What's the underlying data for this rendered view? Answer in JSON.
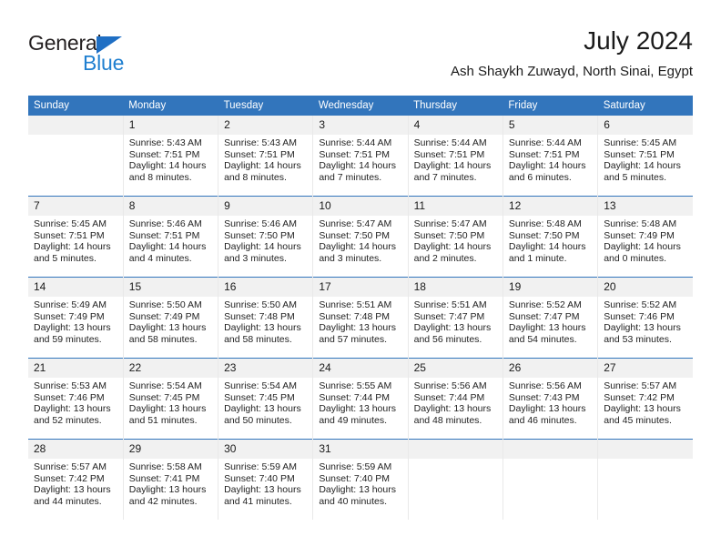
{
  "brand": {
    "name_part1": "General",
    "name_part2": "Blue"
  },
  "header": {
    "title": "July 2024",
    "subtitle": "Ash Shaykh Zuwayd, North Sinai, Egypt"
  },
  "colors": {
    "header_blue": "#3275bc",
    "logo_blue": "#1f7fd0",
    "daynum_band": "#f1f1f1"
  },
  "weekday_headers": [
    "Sunday",
    "Monday",
    "Tuesday",
    "Wednesday",
    "Thursday",
    "Friday",
    "Saturday"
  ],
  "labels": {
    "sunrise_prefix": "Sunrise:",
    "sunset_prefix": "Sunset:",
    "daylight_prefix": "Daylight:"
  },
  "weeks": [
    [
      {
        "day": "",
        "empty": true
      },
      {
        "day": "1",
        "sunrise": "Sunrise: 5:43 AM",
        "sunset": "Sunset: 7:51 PM",
        "daylight1": "Daylight: 14 hours",
        "daylight2": "and 8 minutes."
      },
      {
        "day": "2",
        "sunrise": "Sunrise: 5:43 AM",
        "sunset": "Sunset: 7:51 PM",
        "daylight1": "Daylight: 14 hours",
        "daylight2": "and 8 minutes."
      },
      {
        "day": "3",
        "sunrise": "Sunrise: 5:44 AM",
        "sunset": "Sunset: 7:51 PM",
        "daylight1": "Daylight: 14 hours",
        "daylight2": "and 7 minutes."
      },
      {
        "day": "4",
        "sunrise": "Sunrise: 5:44 AM",
        "sunset": "Sunset: 7:51 PM",
        "daylight1": "Daylight: 14 hours",
        "daylight2": "and 7 minutes."
      },
      {
        "day": "5",
        "sunrise": "Sunrise: 5:44 AM",
        "sunset": "Sunset: 7:51 PM",
        "daylight1": "Daylight: 14 hours",
        "daylight2": "and 6 minutes."
      },
      {
        "day": "6",
        "sunrise": "Sunrise: 5:45 AM",
        "sunset": "Sunset: 7:51 PM",
        "daylight1": "Daylight: 14 hours",
        "daylight2": "and 5 minutes."
      }
    ],
    [
      {
        "day": "7",
        "sunrise": "Sunrise: 5:45 AM",
        "sunset": "Sunset: 7:51 PM",
        "daylight1": "Daylight: 14 hours",
        "daylight2": "and 5 minutes."
      },
      {
        "day": "8",
        "sunrise": "Sunrise: 5:46 AM",
        "sunset": "Sunset: 7:51 PM",
        "daylight1": "Daylight: 14 hours",
        "daylight2": "and 4 minutes."
      },
      {
        "day": "9",
        "sunrise": "Sunrise: 5:46 AM",
        "sunset": "Sunset: 7:50 PM",
        "daylight1": "Daylight: 14 hours",
        "daylight2": "and 3 minutes."
      },
      {
        "day": "10",
        "sunrise": "Sunrise: 5:47 AM",
        "sunset": "Sunset: 7:50 PM",
        "daylight1": "Daylight: 14 hours",
        "daylight2": "and 3 minutes."
      },
      {
        "day": "11",
        "sunrise": "Sunrise: 5:47 AM",
        "sunset": "Sunset: 7:50 PM",
        "daylight1": "Daylight: 14 hours",
        "daylight2": "and 2 minutes."
      },
      {
        "day": "12",
        "sunrise": "Sunrise: 5:48 AM",
        "sunset": "Sunset: 7:50 PM",
        "daylight1": "Daylight: 14 hours",
        "daylight2": "and 1 minute."
      },
      {
        "day": "13",
        "sunrise": "Sunrise: 5:48 AM",
        "sunset": "Sunset: 7:49 PM",
        "daylight1": "Daylight: 14 hours",
        "daylight2": "and 0 minutes."
      }
    ],
    [
      {
        "day": "14",
        "sunrise": "Sunrise: 5:49 AM",
        "sunset": "Sunset: 7:49 PM",
        "daylight1": "Daylight: 13 hours",
        "daylight2": "and 59 minutes."
      },
      {
        "day": "15",
        "sunrise": "Sunrise: 5:50 AM",
        "sunset": "Sunset: 7:49 PM",
        "daylight1": "Daylight: 13 hours",
        "daylight2": "and 58 minutes."
      },
      {
        "day": "16",
        "sunrise": "Sunrise: 5:50 AM",
        "sunset": "Sunset: 7:48 PM",
        "daylight1": "Daylight: 13 hours",
        "daylight2": "and 58 minutes."
      },
      {
        "day": "17",
        "sunrise": "Sunrise: 5:51 AM",
        "sunset": "Sunset: 7:48 PM",
        "daylight1": "Daylight: 13 hours",
        "daylight2": "and 57 minutes."
      },
      {
        "day": "18",
        "sunrise": "Sunrise: 5:51 AM",
        "sunset": "Sunset: 7:47 PM",
        "daylight1": "Daylight: 13 hours",
        "daylight2": "and 56 minutes."
      },
      {
        "day": "19",
        "sunrise": "Sunrise: 5:52 AM",
        "sunset": "Sunset: 7:47 PM",
        "daylight1": "Daylight: 13 hours",
        "daylight2": "and 54 minutes."
      },
      {
        "day": "20",
        "sunrise": "Sunrise: 5:52 AM",
        "sunset": "Sunset: 7:46 PM",
        "daylight1": "Daylight: 13 hours",
        "daylight2": "and 53 minutes."
      }
    ],
    [
      {
        "day": "21",
        "sunrise": "Sunrise: 5:53 AM",
        "sunset": "Sunset: 7:46 PM",
        "daylight1": "Daylight: 13 hours",
        "daylight2": "and 52 minutes."
      },
      {
        "day": "22",
        "sunrise": "Sunrise: 5:54 AM",
        "sunset": "Sunset: 7:45 PM",
        "daylight1": "Daylight: 13 hours",
        "daylight2": "and 51 minutes."
      },
      {
        "day": "23",
        "sunrise": "Sunrise: 5:54 AM",
        "sunset": "Sunset: 7:45 PM",
        "daylight1": "Daylight: 13 hours",
        "daylight2": "and 50 minutes."
      },
      {
        "day": "24",
        "sunrise": "Sunrise: 5:55 AM",
        "sunset": "Sunset: 7:44 PM",
        "daylight1": "Daylight: 13 hours",
        "daylight2": "and 49 minutes."
      },
      {
        "day": "25",
        "sunrise": "Sunrise: 5:56 AM",
        "sunset": "Sunset: 7:44 PM",
        "daylight1": "Daylight: 13 hours",
        "daylight2": "and 48 minutes."
      },
      {
        "day": "26",
        "sunrise": "Sunrise: 5:56 AM",
        "sunset": "Sunset: 7:43 PM",
        "daylight1": "Daylight: 13 hours",
        "daylight2": "and 46 minutes."
      },
      {
        "day": "27",
        "sunrise": "Sunrise: 5:57 AM",
        "sunset": "Sunset: 7:42 PM",
        "daylight1": "Daylight: 13 hours",
        "daylight2": "and 45 minutes."
      }
    ],
    [
      {
        "day": "28",
        "sunrise": "Sunrise: 5:57 AM",
        "sunset": "Sunset: 7:42 PM",
        "daylight1": "Daylight: 13 hours",
        "daylight2": "and 44 minutes."
      },
      {
        "day": "29",
        "sunrise": "Sunrise: 5:58 AM",
        "sunset": "Sunset: 7:41 PM",
        "daylight1": "Daylight: 13 hours",
        "daylight2": "and 42 minutes."
      },
      {
        "day": "30",
        "sunrise": "Sunrise: 5:59 AM",
        "sunset": "Sunset: 7:40 PM",
        "daylight1": "Daylight: 13 hours",
        "daylight2": "and 41 minutes."
      },
      {
        "day": "31",
        "sunrise": "Sunrise: 5:59 AM",
        "sunset": "Sunset: 7:40 PM",
        "daylight1": "Daylight: 13 hours",
        "daylight2": "and 40 minutes."
      },
      {
        "day": "",
        "empty": true
      },
      {
        "day": "",
        "empty": true
      },
      {
        "day": "",
        "empty": true
      }
    ]
  ]
}
